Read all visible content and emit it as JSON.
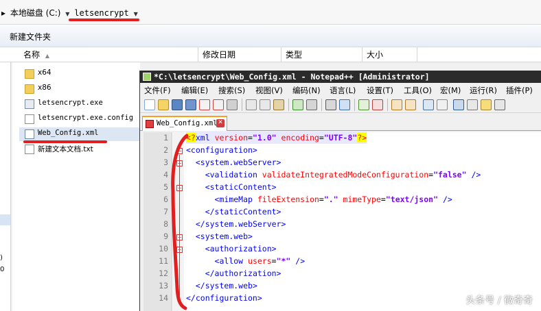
{
  "explorer": {
    "breadcrumb": {
      "prefix_arrow": "▸",
      "drive": "本地磁盘 (C:)",
      "folder": "letsencrypt"
    },
    "toolbar": {
      "new_folder": "新建文件夹"
    },
    "columns": {
      "name": "名称",
      "sort_indicator": "▲",
      "modified": "修改日期",
      "type": "类型",
      "size": "大小"
    },
    "nav_pane_text": [
      ")",
      "0"
    ],
    "files": [
      {
        "name": "x64",
        "icon": "folder-icon"
      },
      {
        "name": "x86",
        "icon": "folder-icon"
      },
      {
        "name": "letsencrypt.exe",
        "icon": "exe-icon"
      },
      {
        "name": "letsencrypt.exe.config",
        "icon": "config-file-icon"
      },
      {
        "name": "Web_Config.xml",
        "icon": "xml-file-icon"
      },
      {
        "name": "新建文本文档.txt",
        "icon": "text-file-icon"
      }
    ]
  },
  "notepad": {
    "title": "*C:\\letsencrypt\\Web_Config.xml - Notepad++ [Administrator]",
    "menu": [
      "文件(F)",
      "编辑(E)",
      "搜索(S)",
      "视图(V)",
      "编码(N)",
      "语言(L)",
      "设置(T)",
      "工具(O)",
      "宏(M)",
      "运行(R)",
      "插件(P)"
    ],
    "tab_label": "Web_Config.xml",
    "line_numbers": [
      "1",
      "2",
      "3",
      "4",
      "5",
      "6",
      "7",
      "8",
      "9",
      "10",
      "11",
      "12",
      "13",
      "14"
    ],
    "code": [
      [
        [
          "pi",
          "<?"
        ],
        [
          "tag",
          "xml "
        ],
        [
          "attr",
          "version"
        ],
        [
          "eq",
          "="
        ],
        [
          "val",
          "\"1.0\""
        ],
        [
          "attr",
          " encoding"
        ],
        [
          "eq",
          "="
        ],
        [
          "val",
          "\"UTF-8\""
        ],
        [
          "pi",
          "?>"
        ]
      ],
      [
        [
          "tag",
          "<configuration>"
        ]
      ],
      [
        [
          "sp",
          "  "
        ],
        [
          "tag",
          "<system.webServer>"
        ]
      ],
      [
        [
          "sp",
          "    "
        ],
        [
          "tag",
          "<validation "
        ],
        [
          "attr",
          "validateIntegratedModeConfiguration"
        ],
        [
          "eq",
          "="
        ],
        [
          "val",
          "\"false\""
        ],
        [
          "tag",
          " />"
        ]
      ],
      [
        [
          "sp",
          "    "
        ],
        [
          "tag",
          "<staticContent>"
        ]
      ],
      [
        [
          "sp",
          "      "
        ],
        [
          "tag",
          "<mimeMap "
        ],
        [
          "attr",
          "fileExtension"
        ],
        [
          "eq",
          "="
        ],
        [
          "val",
          "\".\""
        ],
        [
          "attr",
          " mimeType"
        ],
        [
          "eq",
          "="
        ],
        [
          "val",
          "\"text/json\""
        ],
        [
          "tag",
          " />"
        ]
      ],
      [
        [
          "sp",
          "    "
        ],
        [
          "tag",
          "</staticContent>"
        ]
      ],
      [
        [
          "sp",
          "  "
        ],
        [
          "tag",
          "</system.webServer>"
        ]
      ],
      [
        [
          "sp",
          "  "
        ],
        [
          "tag",
          "<system.web>"
        ]
      ],
      [
        [
          "sp",
          "    "
        ],
        [
          "tag",
          "<authorization>"
        ]
      ],
      [
        [
          "sp",
          "      "
        ],
        [
          "tag",
          "<allow "
        ],
        [
          "attr",
          "users"
        ],
        [
          "eq",
          "="
        ],
        [
          "val",
          "\"*\""
        ],
        [
          "tag",
          " />"
        ]
      ],
      [
        [
          "sp",
          "    "
        ],
        [
          "tag",
          "</authorization>"
        ]
      ],
      [
        [
          "sp",
          "  "
        ],
        [
          "tag",
          "</system.web>"
        ]
      ],
      [
        [
          "tag",
          "</configuration>"
        ]
      ]
    ]
  },
  "watermark": "头条号 / 微奇奇",
  "colors": {
    "accent_red": "#e02020",
    "title_bar": "#2b2b2b",
    "xml_tag": "#0000ff",
    "xml_attr": "#ff0000",
    "xml_value": "#8000ff"
  }
}
